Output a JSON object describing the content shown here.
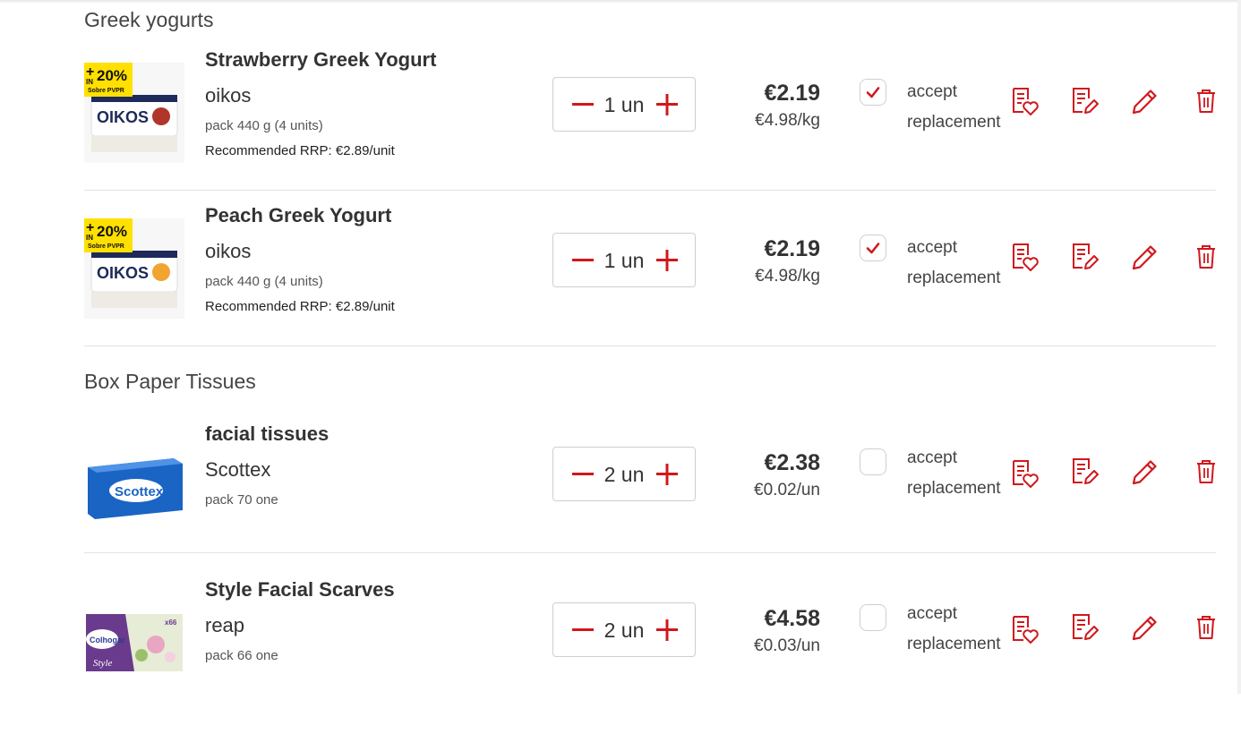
{
  "categories": [
    {
      "title": "Greek yogurts",
      "products": [
        {
          "name": "Strawberry Greek Yogurt",
          "brand": "oikos",
          "pack": "pack 440 g (4 units)",
          "rrp": "Recommended RRP: €2.89/unit",
          "qty": "1 un",
          "price": "€2.19",
          "unit_price": "€4.98/kg",
          "accept_label": "accept",
          "replacement_label": "replacement",
          "accept_checked": true,
          "promo": {
            "percent": "20%",
            "in": "IN",
            "sub": "Sobre PVPR"
          },
          "fruit_color": "#b0352b"
        },
        {
          "name": "Peach Greek Yogurt",
          "brand": "oikos",
          "pack": "pack 440 g (4 units)",
          "rrp": "Recommended RRP: €2.89/unit",
          "qty": "1 un",
          "price": "€2.19",
          "unit_price": "€4.98/kg",
          "accept_label": "accept",
          "replacement_label": "replacement",
          "accept_checked": true,
          "promo": {
            "percent": "20%",
            "in": "IN",
            "sub": "Sobre PVPR"
          },
          "fruit_color": "#f2a431"
        }
      ]
    },
    {
      "title": "Box Paper Tissues",
      "products": [
        {
          "name": "facial tissues",
          "brand": "Scottex",
          "pack": "pack 70 one",
          "qty": "2 un",
          "price": "€2.38",
          "unit_price": "€0.02/un",
          "accept_label": "accept",
          "replacement_label": "replacement",
          "accept_checked": false
        },
        {
          "name": "Style Facial Scarves",
          "brand": "reap",
          "pack": "pack 66 one",
          "qty": "2 un",
          "price": "€4.58",
          "unit_price": "€0.03/un",
          "accept_label": "accept",
          "replacement_label": "replacement",
          "accept_checked": false
        }
      ]
    }
  ],
  "product_images": {
    "yogurt_brand": "OIKOS",
    "scottex_brand": "Scottex",
    "colhogar_brand": "Colhogar",
    "colhogar_style": "Style",
    "colhogar_count": "x66"
  },
  "icons": [
    "minus-icon",
    "plus-icon",
    "check-icon",
    "shopping-list-heart-icon",
    "note-edit-icon",
    "pencil-icon",
    "trash-icon"
  ],
  "colors": {
    "accent": "#d0181d",
    "promo_yellow": "#ffe000",
    "scottex_blue": "#1a64c4"
  }
}
